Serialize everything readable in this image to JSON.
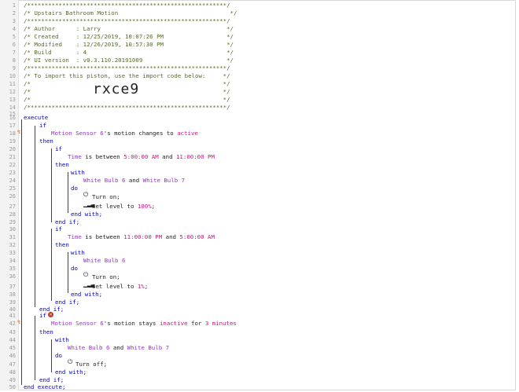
{
  "header": {
    "stars": "/*********************************************************/",
    "title": "/* Upstairs Bathroom Motion                                */",
    "author": "/* Author      : Larry                                    */",
    "created": "/* Created     : 12/25/2019, 10:07:26 PM                  */",
    "modified": "/* Modified    : 12/26/2019, 10:57:30 PM                  */",
    "build": "/* Build       : 4                                        */",
    "ui": "/* UI version  : v0.3.110.20191009                        */",
    "import": "/* To import this piston, use the import code below:     */",
    "empty": "/*                                                       */",
    "code": "rxce9"
  },
  "line_numbers": [
    "1",
    "2",
    "3",
    "4",
    "5",
    "6",
    "7",
    "8",
    "9",
    "10",
    "11",
    "12",
    "13",
    "14",
    "15",
    "16",
    "17",
    "18",
    "19",
    "20",
    "21",
    "22",
    "23",
    "24",
    "25",
    "26",
    "27",
    "28",
    "29",
    "30",
    "31",
    "32",
    "33",
    "34",
    "35",
    "36",
    "37",
    "38",
    "39",
    "40",
    "41",
    "42",
    "43",
    "44",
    "45",
    "46",
    "47",
    "48",
    "49",
    "50"
  ],
  "code": {
    "execute": "execute",
    "end_execute": "end execute;",
    "if": "if",
    "then": "then",
    "end_if": "end if;",
    "with": "with",
    "do": "do",
    "end_with": "end with;",
    "motion1_dev": "Motion Sensor 6",
    "motion1_tail": "'s motion changes to ",
    "motion1_val": "active",
    "time1_a": "Time",
    "time1_b": " is between ",
    "time1_c": "5:00:00 AM",
    "time1_d": " and ",
    "time1_e": "11:00:00 PM",
    "dev_b6": "White Bulb 6",
    "and": " and ",
    "dev_b7": "White Bulb 7",
    "turn_on": "Turn on;",
    "set_level_a": "Set level to ",
    "level100": "100%",
    "semicolon": ";",
    "time2_c": "11:00:00 PM",
    "time2_e": "5:00:00 AM",
    "level1": "1%",
    "motion2_dev": "Motion Sensor 6",
    "motion2_tail": "'s motion stays ",
    "motion2_val": "inactive",
    "motion2_for": " for ",
    "motion2_dur": "3 minutes",
    "turn_off": "Turn off;"
  }
}
